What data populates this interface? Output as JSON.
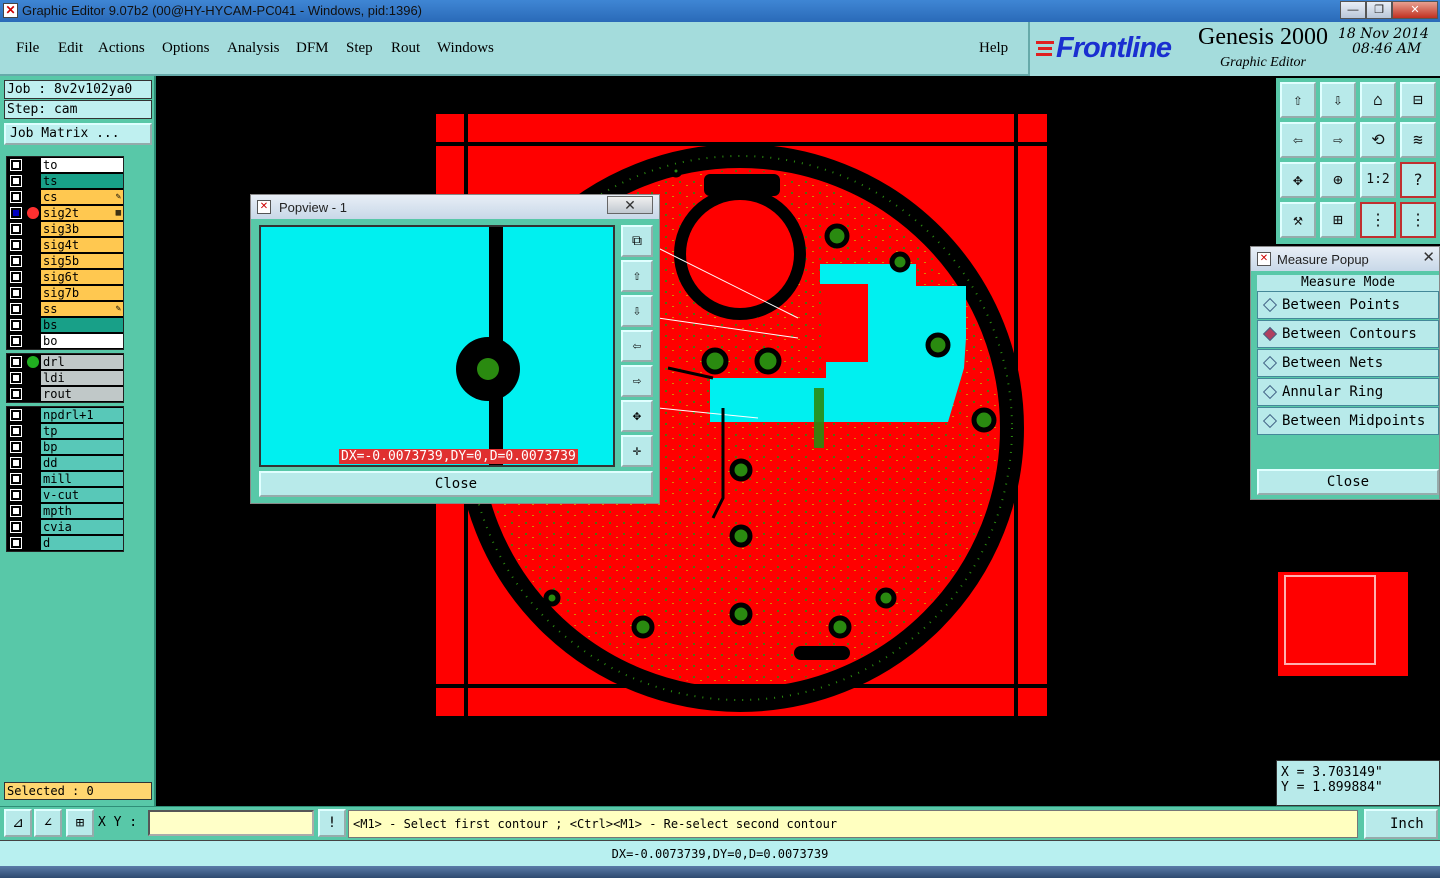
{
  "window": {
    "title": "Graphic Editor 9.07b2 (00@HY-HYCAM-PC041 - Windows, pid:1396)",
    "controls": [
      "—",
      "❐",
      "✕"
    ]
  },
  "menu": [
    "File",
    "Edit",
    "Actions",
    "Options",
    "Analysis",
    "DFM",
    "Step",
    "Rout",
    "Windows",
    "Help"
  ],
  "brand": {
    "logo": "Frontline",
    "product": "Genesis 2000",
    "subtitle": "Graphic Editor",
    "date": "18 Nov 2014",
    "time": "08:46 AM"
  },
  "left": {
    "job": "Job : 8v2v102ya0",
    "step": "Step: cam",
    "job_matrix": "Job Matrix ...",
    "groups": [
      [
        {
          "name": "to",
          "color": "#ffffff"
        },
        {
          "name": "ts",
          "color": "#18a088"
        },
        {
          "name": "cs",
          "color": "#ffc850",
          "mark": "✎"
        },
        {
          "name": "sig2t",
          "color": "#ffc850",
          "mark": "▦",
          "active": true
        },
        {
          "name": "sig3b",
          "color": "#ffc850"
        },
        {
          "name": "sig4t",
          "color": "#ffc850"
        },
        {
          "name": "sig5b",
          "color": "#ffc850"
        },
        {
          "name": "sig6t",
          "color": "#ffc850"
        },
        {
          "name": "sig7b",
          "color": "#ffc850"
        },
        {
          "name": "ss",
          "color": "#ffc850",
          "mark": "✎"
        },
        {
          "name": "bs",
          "color": "#18a088"
        },
        {
          "name": "bo",
          "color": "#ffffff"
        }
      ],
      [
        {
          "name": "drl",
          "color": "#c0c8c8",
          "dot": "#20b020"
        },
        {
          "name": "ldi",
          "color": "#c0c8c8"
        },
        {
          "name": "rout",
          "color": "#c0c8c8"
        }
      ],
      [
        {
          "name": "npdrl+1",
          "color": "#58c8b8"
        },
        {
          "name": "tp",
          "color": "#58c8b8"
        },
        {
          "name": "bp",
          "color": "#58c8b8"
        },
        {
          "name": "dd",
          "color": "#58c8b8"
        },
        {
          "name": "mill",
          "color": "#58c8b8"
        },
        {
          "name": "v-cut",
          "color": "#58c8b8"
        },
        {
          "name": "mpth",
          "color": "#58c8b8"
        },
        {
          "name": "cvia",
          "color": "#58c8b8"
        },
        {
          "name": "d",
          "color": "#58c8b8"
        }
      ]
    ],
    "selected": "Selected : 0"
  },
  "popview": {
    "title": "Popview - 1",
    "readout": "DX=-0.0073739,DY=0,D=0.0073739",
    "close": "Close",
    "tools": [
      "⧉",
      "⇧",
      "⇩",
      "⇦",
      "⇨",
      "✥",
      "✛"
    ]
  },
  "measure": {
    "title": "Measure Popup",
    "heading": "Measure Mode",
    "options": [
      {
        "label": "Between Points",
        "selected": false
      },
      {
        "label": "Between Contours",
        "selected": true
      },
      {
        "label": "Between Nets",
        "selected": false
      },
      {
        "label": "Annular Ring",
        "selected": false
      },
      {
        "label": "Between Midpoints",
        "selected": false
      }
    ],
    "close": "Close"
  },
  "tools": [
    "⇧",
    "⇩",
    "⌂",
    "⊟",
    "⇦",
    "⇨",
    "⟲",
    "≋",
    "✥",
    "⊕",
    "1:2",
    "?",
    "⚒",
    "⊞",
    "⋮",
    "⋮"
  ],
  "coords": {
    "x": "X = 3.703149\"",
    "y": "Y = 1.899884\""
  },
  "command": {
    "xy_label": "X Y :",
    "xy_value": "",
    "warn": "!",
    "prompt": "<M1> - Select first contour ; <Ctrl><M1> - Re-select second contour",
    "units": "Inch"
  },
  "status": "DX=-0.0073739,DY=0,D=0.0073739",
  "colors": {
    "board": "#ff0000",
    "highlight": "#00f0f0",
    "pad": "#2a8a10",
    "panel": "#58c8a8"
  }
}
